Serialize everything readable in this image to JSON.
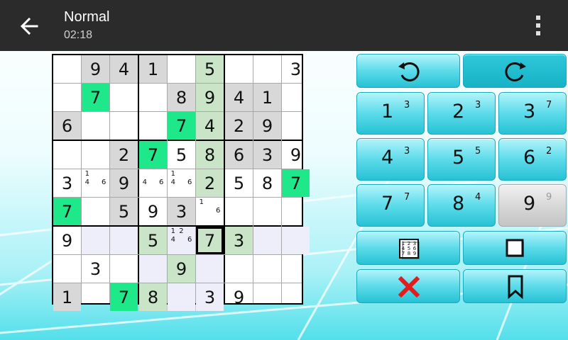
{
  "app": {
    "title": "Normal",
    "timer": "02:18"
  },
  "icons": {
    "back": "arrow-left-icon",
    "menu": "more-vertical-icon",
    "undo": "undo-icon",
    "redo": "redo-icon",
    "notes": "pencil-marks-icon",
    "erase_square": "square-icon",
    "clear": "x-icon",
    "bookmark": "bookmark-icon"
  },
  "colors": {
    "topbar": "#2b2b2b",
    "highlight_green": "#1ee88a",
    "related_green": "#c9e4c7",
    "given_gray": "#d8d8d8",
    "related_lavender": "#eeeefa",
    "button_cyan": "#5fdcea",
    "delete_red": "#e31c1c"
  },
  "board": {
    "values": [
      [
        "",
        "9",
        "4",
        "1",
        "",
        "5",
        "",
        "",
        "3"
      ],
      [
        "",
        "7",
        "",
        "",
        "8",
        "9",
        "4",
        "1",
        ""
      ],
      [
        "6",
        "",
        "",
        "",
        "7",
        "4",
        "2",
        "9",
        ""
      ],
      [
        "",
        "",
        "2",
        "7",
        "5",
        "8",
        "6",
        "3",
        "9"
      ],
      [
        "3",
        "",
        "9",
        "",
        "",
        "2",
        "5",
        "8",
        "7"
      ],
      [
        "7",
        "",
        "5",
        "9",
        "3",
        "",
        "",
        "",
        ""
      ],
      [
        "9",
        "",
        "",
        "5",
        "",
        "7",
        "3",
        "",
        ""
      ],
      [
        "",
        "3",
        "",
        "",
        "9",
        "",
        "",
        "",
        ""
      ],
      [
        "1",
        "",
        "7",
        "8",
        "",
        "3",
        "9",
        "",
        ""
      ]
    ],
    "styles": [
      [
        "",
        "given",
        "given",
        "given",
        "",
        "lightgreen",
        "",
        "",
        ""
      ],
      [
        "",
        "green",
        "",
        "",
        "given",
        "lightgreen",
        "given",
        "given",
        ""
      ],
      [
        "given",
        "",
        "",
        "",
        "green",
        "lightgreen",
        "given",
        "given",
        ""
      ],
      [
        "",
        "",
        "given",
        "green",
        "",
        "lightgreen",
        "given",
        "given",
        ""
      ],
      [
        "",
        "",
        "given",
        "",
        "",
        "lightgreen",
        "",
        "",
        "green"
      ],
      [
        "green",
        "",
        "given",
        "",
        "given",
        "",
        "",
        "",
        ""
      ],
      [
        "",
        "lavender",
        "lavender",
        "lightgreen",
        "lavender",
        "selected",
        "lightgreen",
        "lavender",
        "lavender"
      ],
      [
        "",
        "",
        "",
        "lavender",
        "lightgreen",
        "lavender",
        "",
        "",
        ""
      ],
      [
        "given",
        "",
        "green",
        "lightgreen",
        "lavender",
        "lavender",
        "",
        "",
        ""
      ]
    ],
    "notes": [
      {
        "r": 4,
        "c": 1,
        "marks": [
          "1",
          "",
          "",
          "4",
          "",
          "6",
          "",
          "",
          ""
        ]
      },
      {
        "r": 4,
        "c": 3,
        "marks": [
          "",
          "",
          "",
          "4",
          "",
          "6",
          "",
          "",
          ""
        ]
      },
      {
        "r": 4,
        "c": 4,
        "marks": [
          "1",
          "",
          "",
          "4",
          "",
          "6",
          "",
          "",
          ""
        ]
      },
      {
        "r": 5,
        "c": 5,
        "marks": [
          "1",
          "",
          "",
          "",
          "",
          "6",
          "",
          "",
          ""
        ]
      },
      {
        "r": 6,
        "c": 4,
        "marks": [
          "1",
          "2",
          "",
          "4",
          "",
          "6",
          "",
          "",
          ""
        ]
      }
    ]
  },
  "keypad": [
    {
      "digit": "1",
      "remaining": "3"
    },
    {
      "digit": "2",
      "remaining": "3"
    },
    {
      "digit": "3",
      "remaining": "7"
    },
    {
      "digit": "4",
      "remaining": "3"
    },
    {
      "digit": "5",
      "remaining": "5"
    },
    {
      "digit": "6",
      "remaining": "2"
    },
    {
      "digit": "7",
      "remaining": "7"
    },
    {
      "digit": "8",
      "remaining": "4"
    },
    {
      "digit": "9",
      "remaining": "9"
    }
  ],
  "notes_icon_digits": [
    "1",
    "2",
    "3",
    "4",
    "5",
    "6",
    "7",
    "8",
    "9"
  ]
}
